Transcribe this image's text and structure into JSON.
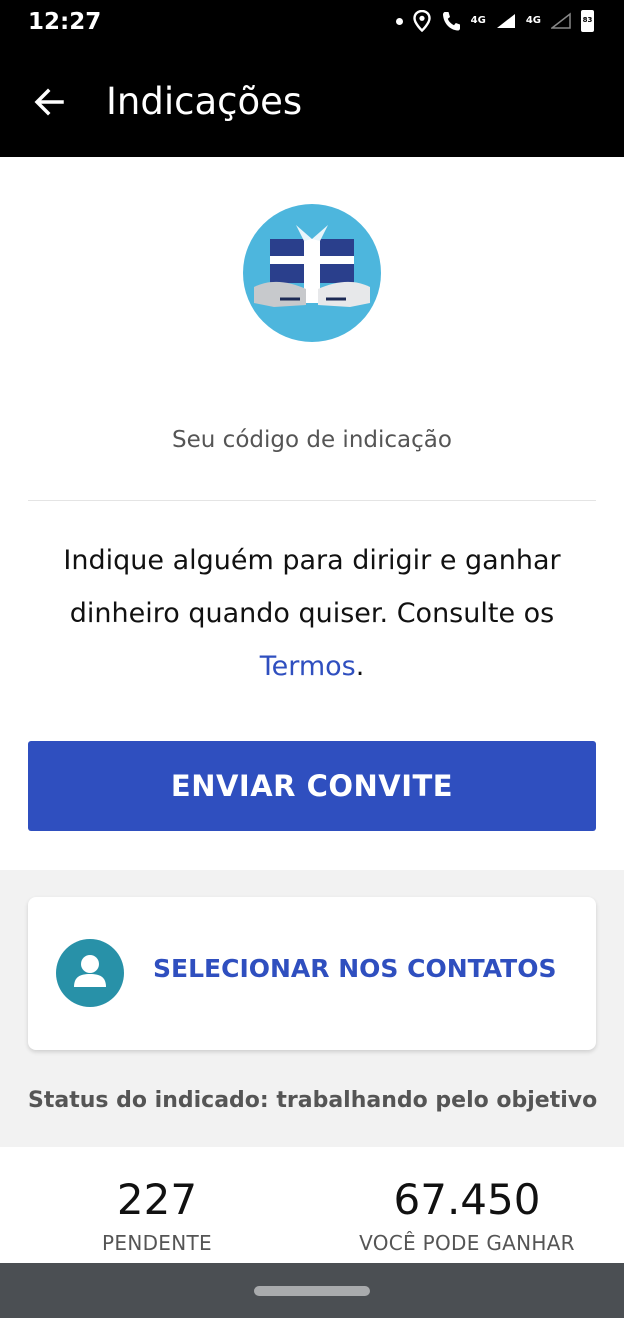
{
  "status_bar": {
    "time": "12:27",
    "network_label": "4G",
    "battery": "83"
  },
  "app_bar": {
    "title": "Indicações"
  },
  "referral": {
    "code_label": "Seu código de indicação",
    "description_line1": "Indique alguém para dirigir e ganhar",
    "description_line2": "dinheiro quando quiser. Consulte os",
    "terms_link": "Termos",
    "terms_suffix": ".",
    "invite_button": "ENVIAR CONVITE"
  },
  "contacts": {
    "label": "SELECIONAR NOS CONTATOS"
  },
  "referee_status": "Status do indicado: trabalhando pelo objetivo",
  "stats": [
    {
      "value": "227",
      "label": "PENDENTE"
    },
    {
      "value": "67.450",
      "label": "VOCÊ PODE GANHAR"
    }
  ],
  "colors": {
    "accent": "#2f4fbf",
    "gift_circle": "#4db6dd",
    "avatar": "#2891a8"
  },
  "icons": [
    "location-icon",
    "phone-icon",
    "signal-icon",
    "battery-icon",
    "back-arrow-icon",
    "gift-icon",
    "contact-avatar-icon"
  ]
}
